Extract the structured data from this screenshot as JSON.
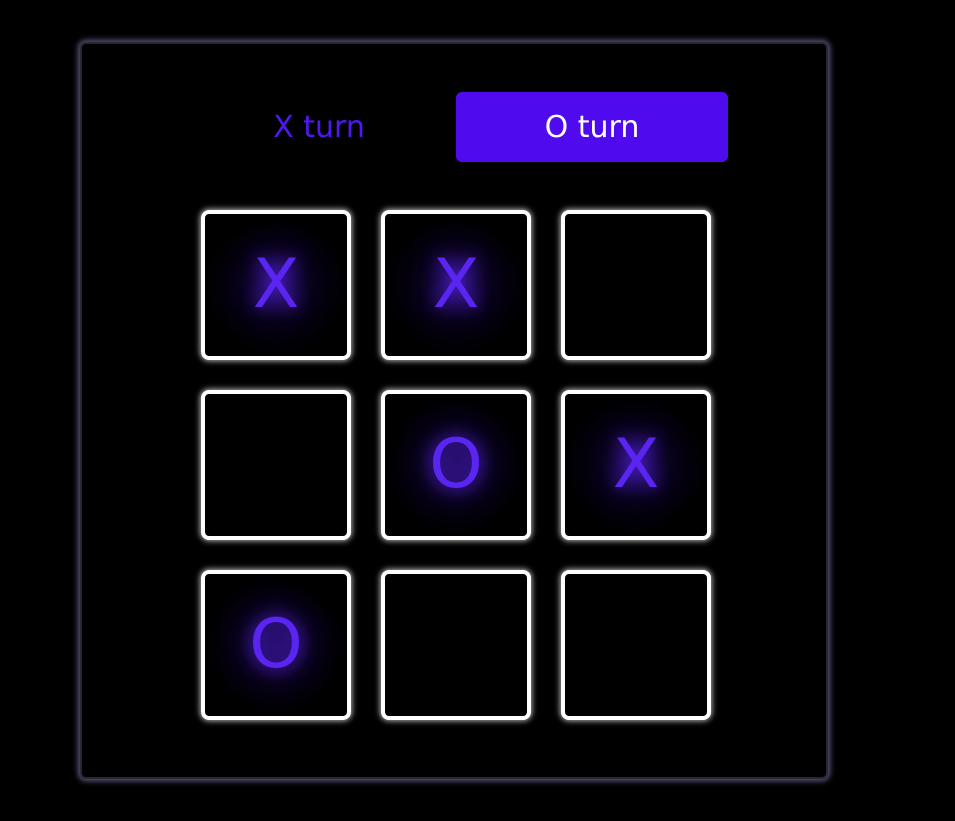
{
  "turns": {
    "x_label": "X turn",
    "o_label": "O turn",
    "active": "O"
  },
  "board": {
    "cells": [
      "X",
      "X",
      "",
      "",
      "O",
      "X",
      "O",
      "",
      ""
    ]
  },
  "colors": {
    "accent": "#4f0bee",
    "mark": "#5a25f0",
    "background": "#000000",
    "cell_border": "#ffffff"
  }
}
